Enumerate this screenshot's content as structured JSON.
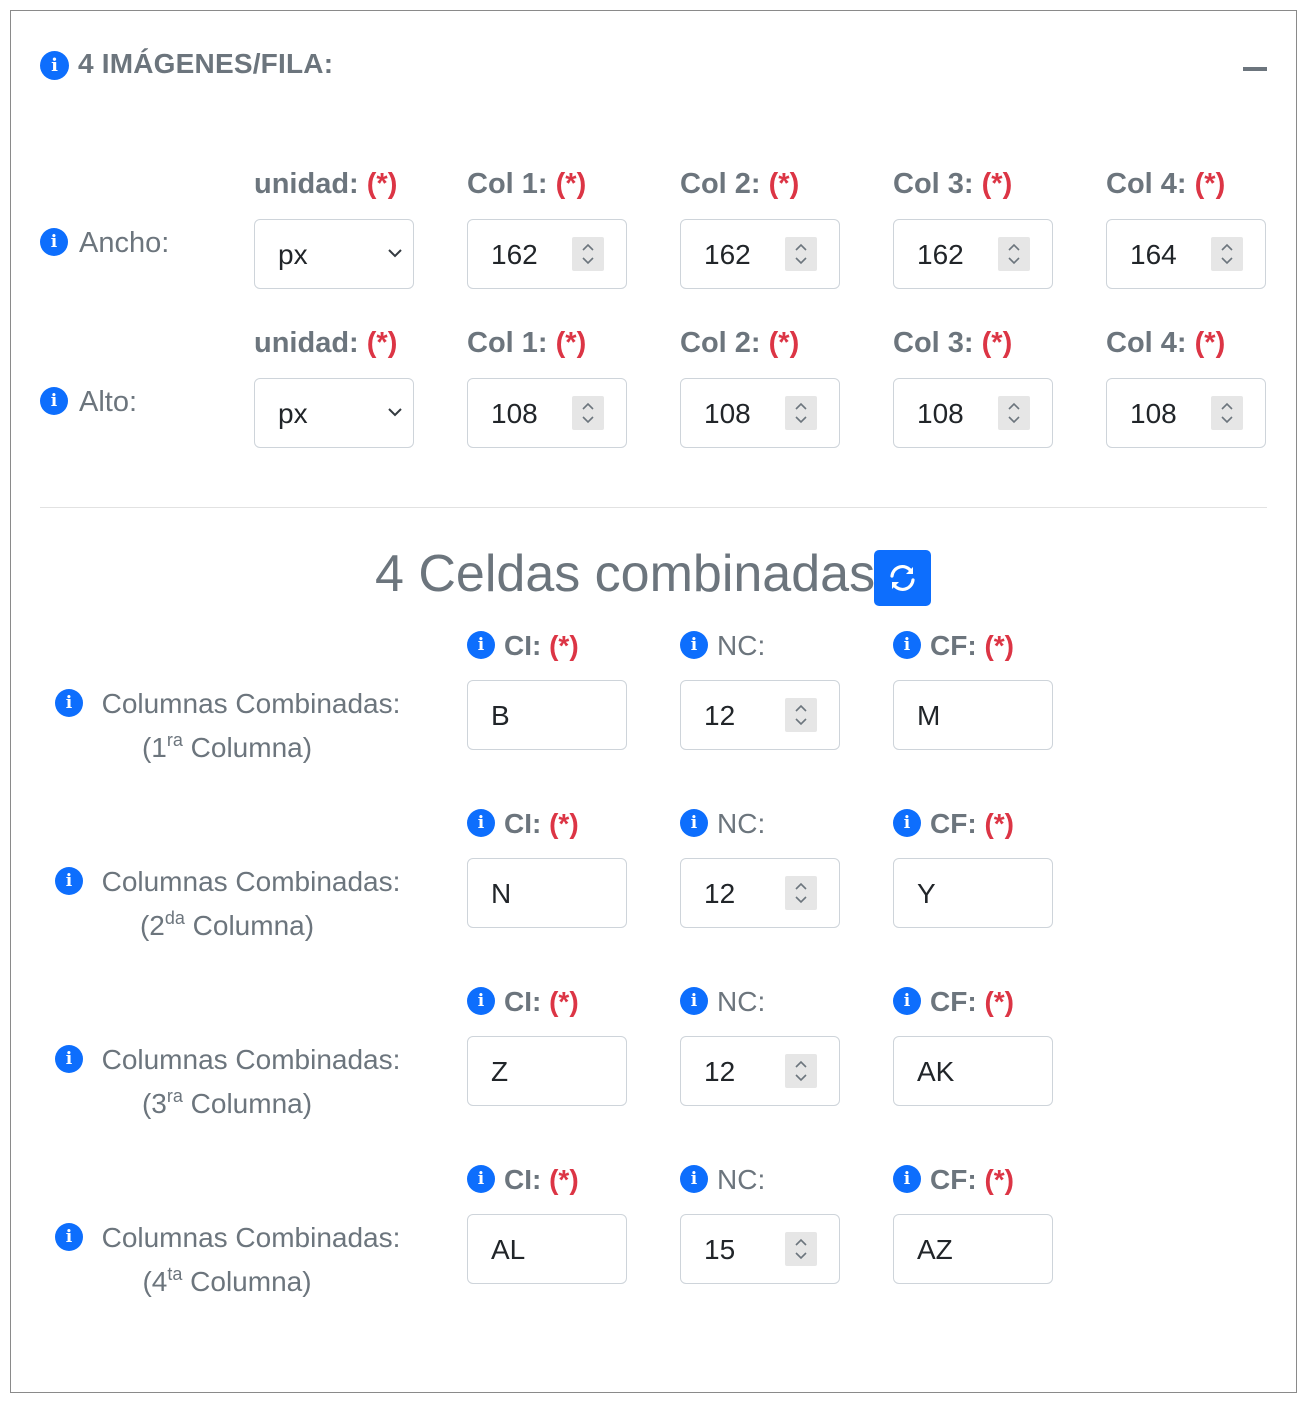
{
  "header": {
    "title": "4 IMÁGENES/FILA:",
    "info_icon": "info-icon",
    "collapse_icon": "minus-icon"
  },
  "required_mark": "(*)",
  "dimensions": {
    "ancho": {
      "label": "Ancho:",
      "unit_label": "unidad:",
      "unit_value": "px",
      "cols": [
        {
          "label": "Col 1:",
          "value": "162"
        },
        {
          "label": "Col 2:",
          "value": "162"
        },
        {
          "label": "Col 3:",
          "value": "162"
        },
        {
          "label": "Col 4:",
          "value": "164"
        }
      ]
    },
    "alto": {
      "label": "Alto:",
      "unit_label": "unidad:",
      "unit_value": "px",
      "cols": [
        {
          "label": "Col 1:",
          "value": "108"
        },
        {
          "label": "Col 2:",
          "value": "108"
        },
        {
          "label": "Col 3:",
          "value": "108"
        },
        {
          "label": "Col 4:",
          "value": "108"
        }
      ]
    }
  },
  "merged": {
    "title": "4 Celdas combinadas",
    "refresh_icon": "refresh-icon",
    "ci_label": "CI:",
    "nc_label": "NC:",
    "cf_label": "CF:",
    "rows": [
      {
        "label": "Columnas Combinadas:",
        "open": "(1",
        "ord": "ra",
        "col": " Columna)",
        "ci": "B",
        "nc": "12",
        "cf": "M"
      },
      {
        "label": "Columnas Combinadas:",
        "open": "(2",
        "ord": "da",
        "col": " Columna)",
        "ci": "N",
        "nc": "12",
        "cf": "Y"
      },
      {
        "label": "Columnas Combinadas:",
        "open": "(3",
        "ord": "ra",
        "col": " Columna)",
        "ci": "Z",
        "nc": "12",
        "cf": "AK"
      },
      {
        "label": "Columnas Combinadas:",
        "open": "(4",
        "ord": "ta",
        "col": " Columna)",
        "ci": "AL",
        "nc": "15",
        "cf": "AZ"
      }
    ]
  },
  "colors": {
    "primary": "#0d6efd",
    "required": "#dc3545",
    "text": "#6c757d"
  }
}
